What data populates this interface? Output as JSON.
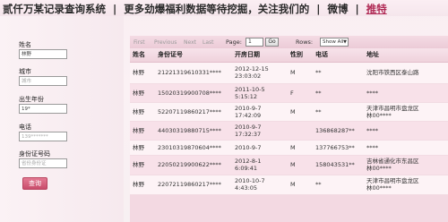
{
  "header": {
    "title": "贰仟万某记录查询系统",
    "separator": "|",
    "tagline": "更多劲爆福利数据等待挖掘，关注我们的",
    "weibo_link": "微博",
    "twitter_link": "推特"
  },
  "sidebar": {
    "name_label": "姓名",
    "name_value": "林野",
    "city_label": "城市",
    "city_placeholder": "城市",
    "birth_label": "出生年份",
    "birth_value": "19*",
    "phone_label": "电话",
    "phone_placeholder": "139*******",
    "id_label": "身份证号码",
    "id_placeholder": "省份身份证",
    "query_button": "查询"
  },
  "pager": {
    "first": "First",
    "previous": "Previous",
    "next": "Next",
    "last": "Last",
    "page_label": "Page:",
    "page_value": "1",
    "go_button": "Go",
    "rows_label": "Rows:",
    "rows_value": "Show All"
  },
  "table": {
    "headers": [
      "姓名",
      "身份证号",
      "开房日期",
      "性别",
      "电话",
      "地址"
    ],
    "rows": [
      [
        "林野",
        "21221319610331****",
        "2012-12-15\n23:03:02",
        "M",
        "**",
        "沈阳市铁西区泰山路"
      ],
      [
        "林野",
        "15020319900708****",
        "2011-10-5\n5:15:12",
        "F",
        "**",
        "****"
      ],
      [
        "林野",
        "52207119860217****",
        "2010-9-7\n17:42:09",
        "M",
        "**",
        "天津市昌明市盘龙区\n林00****"
      ],
      [
        "林野",
        "44030319880715****",
        "2010-9-7\n17:32:37",
        "",
        "136868287**",
        "****"
      ],
      [
        "林野",
        "23010319870604****",
        "2010-9-7",
        "M",
        "137766753**",
        "****"
      ],
      [
        "林野",
        "22050219900622****",
        "2012-8-1\n6:09:41",
        "M",
        "158043531**",
        "吉林省通化市东昌区\n林00****"
      ],
      [
        "林野",
        "22072119860217****",
        "2010-10-7\n4:43:05",
        "M",
        "**",
        "天津市昌明市盘龙区\n林00****"
      ]
    ]
  }
}
